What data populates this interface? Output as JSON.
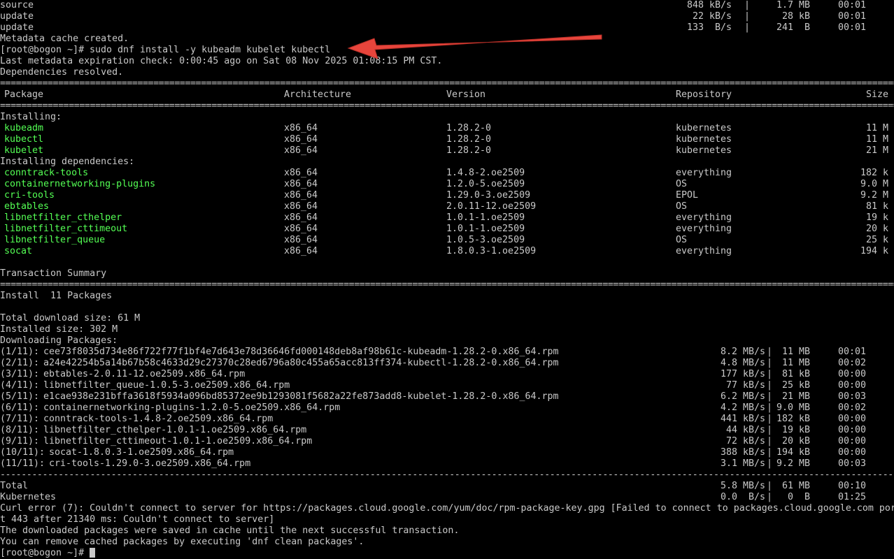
{
  "repo_lines": [
    {
      "name": "source",
      "speed": "848 kB/s",
      "size": "1.7 MB",
      "time": "00:01"
    },
    {
      "name": "update",
      "speed": "22 kB/s",
      "size": "28 kB",
      "time": "00:01"
    },
    {
      "name": "update",
      "speed": "133  B/s",
      "size": "241  B",
      "time": "00:01"
    }
  ],
  "metadata_created": "Metadata cache created.",
  "command": {
    "prompt": "[root@bogon ~]#",
    "text": "sudo dnf install -y kubeadm kubelet kubectl"
  },
  "last_metadata": "Last metadata expiration check: 0:00:45 ago on Sat 08 Nov 2025 01:08:15 PM CST.",
  "deps_resolved": "Dependencies resolved.",
  "separator": "==========================================================================================================================================================================================================================",
  "separator2": "--------------------------------------------------------------------------------------------------------------------------------------------------------------------------------------------------------------------------",
  "table_headers": {
    "package": "Package",
    "arch": "Architecture",
    "version": "Version",
    "repo": "Repository",
    "size": "Size"
  },
  "installing_label": "Installing:",
  "installing": [
    {
      "name": "kubeadm",
      "arch": "x86_64",
      "version": "1.28.2-0",
      "repo": "kubernetes",
      "size": "11 M"
    },
    {
      "name": "kubectl",
      "arch": "x86_64",
      "version": "1.28.2-0",
      "repo": "kubernetes",
      "size": "11 M"
    },
    {
      "name": "kubelet",
      "arch": "x86_64",
      "version": "1.28.2-0",
      "repo": "kubernetes",
      "size": "21 M"
    }
  ],
  "deps_label": "Installing dependencies:",
  "dependencies": [
    {
      "name": "conntrack-tools",
      "arch": "x86_64",
      "version": "1.4.8-2.oe2509",
      "repo": "everything",
      "size": "182 k"
    },
    {
      "name": "containernetworking-plugins",
      "arch": "x86_64",
      "version": "1.2.0-5.oe2509",
      "repo": "OS",
      "size": "9.0 M"
    },
    {
      "name": "cri-tools",
      "arch": "x86_64",
      "version": "1.29.0-3.oe2509",
      "repo": "EPOL",
      "size": "9.2 M"
    },
    {
      "name": "ebtables",
      "arch": "x86_64",
      "version": "2.0.11-12.oe2509",
      "repo": "OS",
      "size": "81 k"
    },
    {
      "name": "libnetfilter_cthelper",
      "arch": "x86_64",
      "version": "1.0.1-1.oe2509",
      "repo": "everything",
      "size": "19 k"
    },
    {
      "name": "libnetfilter_cttimeout",
      "arch": "x86_64",
      "version": "1.0.1-1.oe2509",
      "repo": "everything",
      "size": "20 k"
    },
    {
      "name": "libnetfilter_queue",
      "arch": "x86_64",
      "version": "1.0.5-3.oe2509",
      "repo": "OS",
      "size": "25 k"
    },
    {
      "name": "socat",
      "arch": "x86_64",
      "version": "1.8.0.3-1.oe2509",
      "repo": "everything",
      "size": "194 k"
    }
  ],
  "transaction_summary": "Transaction Summary",
  "install_count": "Install  11 Packages",
  "total_download": "Total download size: 61 M",
  "installed_size": "Installed size: 302 M",
  "downloading": "Downloading Packages:",
  "downloads": [
    {
      "idx": "(1/11):",
      "file": "cee73f8035d734e86f722f77f1bf4e7d643e78d36646fd000148deb8af98b61c-kubeadm-1.28.2-0.x86_64.rpm",
      "speed": "8.2 MB/s",
      "size": "11 MB",
      "time": "00:01"
    },
    {
      "idx": "(2/11):",
      "file": "a24e42254b5a14b67b58c4633d29c27370c28ed6796a80c455a65acc813ff374-kubectl-1.28.2-0.x86_64.rpm",
      "speed": "4.8 MB/s",
      "size": "11 MB",
      "time": "00:02"
    },
    {
      "idx": "(3/11):",
      "file": "ebtables-2.0.11-12.oe2509.x86_64.rpm",
      "speed": "177 kB/s",
      "size": "81 kB",
      "time": "00:00"
    },
    {
      "idx": "(4/11):",
      "file": "libnetfilter_queue-1.0.5-3.oe2509.x86_64.rpm",
      "speed": "77 kB/s",
      "size": "25 kB",
      "time": "00:00"
    },
    {
      "idx": "(5/11):",
      "file": "e1cae938e231bffa3618f5934a096bd85372ee9b1293081f5682a22fe873add8-kubelet-1.28.2-0.x86_64.rpm",
      "speed": "6.2 MB/s",
      "size": "21 MB",
      "time": "00:03"
    },
    {
      "idx": "(6/11):",
      "file": "containernetworking-plugins-1.2.0-5.oe2509.x86_64.rpm",
      "speed": "4.2 MB/s",
      "size": "9.0 MB",
      "time": "00:02"
    },
    {
      "idx": "(7/11):",
      "file": "conntrack-tools-1.4.8-2.oe2509.x86_64.rpm",
      "speed": "441 kB/s",
      "size": "182 kB",
      "time": "00:00"
    },
    {
      "idx": "(8/11):",
      "file": "libnetfilter_cthelper-1.0.1-1.oe2509.x86_64.rpm",
      "speed": "44 kB/s",
      "size": "19 kB",
      "time": "00:00"
    },
    {
      "idx": "(9/11):",
      "file": "libnetfilter_cttimeout-1.0.1-1.oe2509.x86_64.rpm",
      "speed": "72 kB/s",
      "size": "20 kB",
      "time": "00:00"
    },
    {
      "idx": "(10/11):",
      "file": "socat-1.8.0.3-1.oe2509.x86_64.rpm",
      "speed": "388 kB/s",
      "size": "194 kB",
      "time": "00:00"
    },
    {
      "idx": "(11/11):",
      "file": "cri-tools-1.29.0-3.oe2509.x86_64.rpm",
      "speed": "3.1 MB/s",
      "size": "9.2 MB",
      "time": "00:03"
    }
  ],
  "total_row": {
    "name": "Total",
    "speed": "5.8 MB/s",
    "size": "61 MB",
    "time": "00:10"
  },
  "kubernetes_row": {
    "name": "Kubernetes",
    "speed": "0.0  B/s",
    "size": "0  B",
    "time": "01:25"
  },
  "curl_error_1": "Curl error (7): Couldn't connect to server for https://packages.cloud.google.com/yum/doc/rpm-package-key.gpg [Failed to connect to packages.cloud.google.com por",
  "curl_error_2": "t 443 after 21340 ms: Couldn't connect to server]",
  "saved_msg": "The downloaded packages were saved in cache until the next successful transaction.",
  "remove_msg": "You can remove cached packages by executing 'dnf clean packages'.",
  "final_prompt": "[root@bogon ~]#",
  "colors": {
    "background": "#000000",
    "text": "#c9c9c9",
    "package_name": "#54ff54",
    "arrow": "#e8453c"
  }
}
